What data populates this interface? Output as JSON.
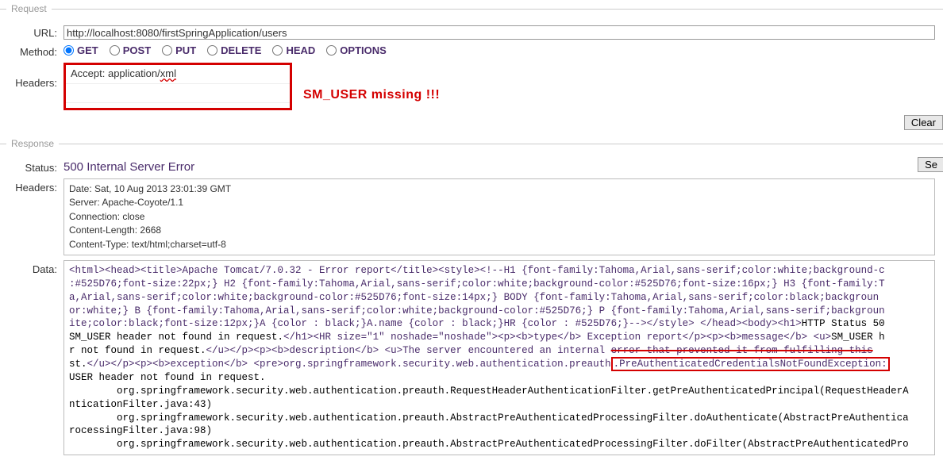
{
  "request": {
    "legend": "Request",
    "urlLabel": "URL:",
    "urlValue": "http://localhost:8080/firstSpringApplication/users",
    "methodLabel": "Method:",
    "methods": {
      "get": "GET",
      "post": "POST",
      "put": "PUT",
      "delete": "DELETE",
      "head": "HEAD",
      "options": "OPTIONS",
      "selected": "GET"
    },
    "headersLabel": "Headers:",
    "headersValue": "Accept: application/",
    "headersXml": "xml",
    "annotation": "SM_USER    missing !!!",
    "clearBtn": "Clear",
    "sendBtn": "Se"
  },
  "response": {
    "legend": "Response",
    "statusLabel": "Status:",
    "statusValue": "500 Internal Server Error",
    "headersLabel": "Headers:",
    "headers": {
      "date": "Date: Sat, 10 Aug 2013 23:01:39 GMT",
      "server": "Server: Apache-Coyote/1.1",
      "connection": "Connection: close",
      "contentLength": "Content-Length: 2668",
      "contentType": "Content-Type: text/html;charset=utf-8"
    },
    "dataLabel": "Data:",
    "data": {
      "p1a": "<html><head><title>Apache Tomcat/7.0.32 - Error report</title><style><!--H1 {font-family:Tahoma,Arial,sans-serif;color:white;background-c",
      "p1b": ":#525D76;font-size:22px;} H2 {font-family:Tahoma,Arial,sans-serif;color:white;background-color:#525D76;font-size:16px;} H3 {font-family:T",
      "p1c": "a,Arial,sans-serif;color:white;background-color:#525D76;font-size:14px;} BODY {font-family:Tahoma,Arial,sans-serif;color:black;backgroun",
      "p1d": "or:white;} B {font-family:Tahoma,Arial,sans-serif;color:white;background-color:#525D76;} P {font-family:Tahoma,Arial,sans-serif;backgroun",
      "p1e": "ite;color:black;font-size:12px;}A {color : black;}A.name {color : black;}HR {color : #525D76;}--></style> </head><body><h1>",
      "p1f": "HTTP Status 50",
      "p2a": "SM_USER header not found in request.",
      "p2b": "</h1><HR size=\"1\" noshade=\"noshade\"><p><b>type</b> Exception report</p><p><b>message</b> <u>",
      "p2c": "SM_USER h",
      "p3a": "r not found in request.",
      "p3b": "</u></p><p><b>description</b> <u>The server encountered an internal ",
      "p3c": "error that prevented it from fulfilling this",
      "p4a": "st.",
      "p4b": "</u></p><p><b>exception</b> <pre>org.springframework.security.web.authentication.preauth",
      "p4c": ".PreAuthenticatedCredentialsNotFoundException:",
      "p5a": "USER header not found in request.",
      "p6": "\torg.springframework.security.web.authentication.preauth.RequestHeaderAuthenticationFilter.getPreAuthenticatedPrincipal(RequestHeaderA",
      "p7": "nticationFilter.java:43)",
      "p8": "\torg.springframework.security.web.authentication.preauth.AbstractPreAuthenticatedProcessingFilter.doAuthenticate(AbstractPreAuthentica",
      "p9": "rocessingFilter.java:98)",
      "p10": "\torg.springframework.security.web.authentication.preauth.AbstractPreAuthenticatedProcessingFilter.doFilter(AbstractPreAuthenticatedPro"
    }
  }
}
